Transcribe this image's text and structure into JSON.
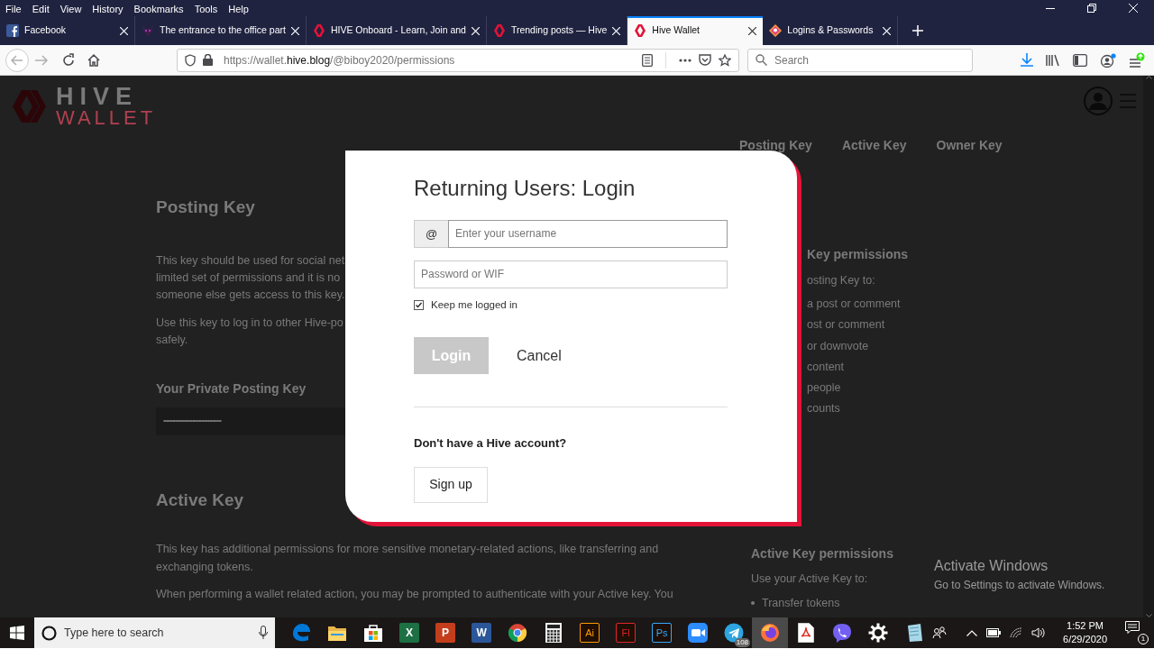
{
  "menu": [
    "File",
    "Edit",
    "View",
    "History",
    "Bookmarks",
    "Tools",
    "Help"
  ],
  "tabs": [
    {
      "label": "Facebook",
      "kind": "facebook",
      "selected": false
    },
    {
      "label": "The entrance to the office part",
      "kind": "creature",
      "selected": false
    },
    {
      "label": "HIVE Onboard - Learn, Join and",
      "kind": "hive",
      "selected": false
    },
    {
      "label": "Trending posts — Hive",
      "kind": "hive",
      "selected": false
    },
    {
      "label": "Hive Wallet",
      "kind": "hive",
      "selected": true
    },
    {
      "label": "Logins & Passwords",
      "kind": "lockwise",
      "selected": false
    }
  ],
  "address": {
    "scheme": "https://wallet.",
    "domain": "hive.blog",
    "path": "/@biboy2020/permissions"
  },
  "search": {
    "placeholder": "Search"
  },
  "site": {
    "logo_top": "HIVE",
    "logo_bottom": "WALLET",
    "key_tabs": [
      "Posting Key",
      "Active Key",
      "Owner Key"
    ],
    "posting": {
      "heading": "Posting Key",
      "paragraphs": [
        [
          "This key should be used for social net",
          "limited set of permissions and it is no",
          "someone else gets access to this key."
        ],
        [
          "Use this key to log in to other Hive-po",
          "safely."
        ]
      ],
      "private_label": "Your Private Posting Key",
      "private_value": "••••••••••••••••••••••••••••••••••••••••••••"
    },
    "posting_permissions": {
      "heading": "Key permissions",
      "intro": "osting Key to:",
      "items": [
        "a post or comment",
        "ost or comment",
        "or downvote",
        "content",
        "people",
        "counts"
      ]
    },
    "active": {
      "heading": "Active Key",
      "paragraphs": [
        "This key has additional permissions for more sensitive monetary-related actions, like transferring and exchanging tokens.",
        "When performing a wallet related action, you may be prompted to authenticate with your Active key. You"
      ]
    },
    "active_permissions": {
      "heading": "Active Key permissions",
      "intro": "Use your Active Key to:",
      "items": [
        "Transfer tokens"
      ]
    }
  },
  "modal": {
    "title": "Returning Users: Login",
    "at": "@",
    "username_placeholder": "Enter your username",
    "password_placeholder": "Password or WIF",
    "keep_logged_in": true,
    "keep_label": "Keep me logged in",
    "login": "Login",
    "login_disabled": true,
    "cancel": "Cancel",
    "no_account": "Don't have a Hive account?",
    "signup": "Sign up"
  },
  "activation_notice": {
    "title": "Activate Windows",
    "text": "Go to Settings to activate Windows."
  },
  "taskbar": {
    "search_placeholder": "Type here to search",
    "apps": [
      {
        "kind": "edge",
        "active": false
      },
      {
        "kind": "folder",
        "active": false
      },
      {
        "kind": "store",
        "active": false
      },
      {
        "kind": "letter",
        "label": "X",
        "color": "#1d7044",
        "active": false
      },
      {
        "kind": "letter",
        "label": "P",
        "color": "#c43e1c",
        "active": false
      },
      {
        "kind": "letter",
        "label": "W",
        "color": "#2b579a",
        "active": false
      },
      {
        "kind": "chrome",
        "active": false
      },
      {
        "kind": "calculator",
        "active": false
      },
      {
        "kind": "outline",
        "label": "Ai",
        "color": "#ff9a00",
        "active": false
      },
      {
        "kind": "outline",
        "label": "Fl",
        "color": "#e0242b",
        "active": false
      },
      {
        "kind": "outline",
        "label": "Ps",
        "color": "#31a8ff",
        "active": false
      },
      {
        "kind": "zoom",
        "active": false
      },
      {
        "kind": "telegram",
        "badge": "108",
        "active": false
      },
      {
        "kind": "firefox",
        "active": true
      },
      {
        "kind": "pdf",
        "active": false
      },
      {
        "kind": "viber",
        "active": false
      },
      {
        "kind": "gear",
        "active": false
      },
      {
        "kind": "notepad",
        "active": false
      }
    ],
    "time": "1:52 PM",
    "date": "6/29/2020",
    "notifications": "1"
  }
}
